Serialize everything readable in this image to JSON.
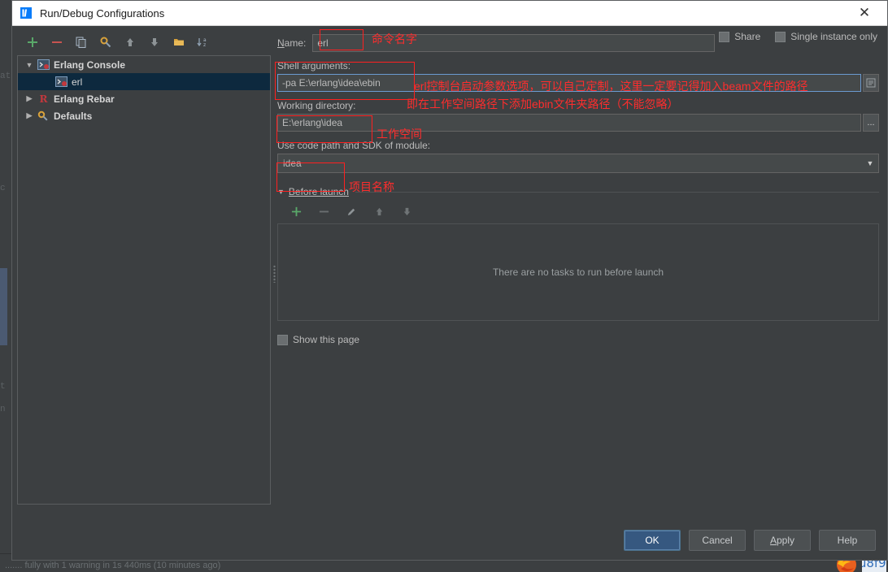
{
  "window": {
    "title": "Run/Debug Configurations",
    "app_icon": "intellij-idea-icon",
    "close_icon": "close-icon"
  },
  "left_pane": {
    "toolbar": [
      {
        "name": "add-button",
        "icon": "plus-icon",
        "glyph": "+"
      },
      {
        "name": "remove-button",
        "icon": "minus-icon",
        "glyph": "−"
      },
      {
        "name": "copy-button",
        "icon": "copy-icon",
        "glyph": "❐"
      },
      {
        "name": "edit-templates-button",
        "icon": "wrench-gear-icon",
        "glyph": "⚙"
      },
      {
        "name": "move-up-button",
        "icon": "arrow-up-icon",
        "glyph": "↑"
      },
      {
        "name": "move-down-button",
        "icon": "arrow-down-icon",
        "glyph": "↓"
      },
      {
        "name": "move-into-folder-button",
        "icon": "folder-icon",
        "glyph": "▬"
      },
      {
        "name": "sort-button",
        "icon": "sort-alphabetical-icon",
        "glyph": "↓az"
      }
    ],
    "tree": [
      {
        "label": "Erlang Console",
        "level": 0,
        "expanded": true,
        "twisty": "▼",
        "icon": "erlang-console-icon",
        "selected": false,
        "bold": true
      },
      {
        "label": "erl",
        "level": 1,
        "expanded": null,
        "twisty": "",
        "icon": "erlang-console-icon",
        "selected": true,
        "bold": false
      },
      {
        "label": "Erlang Rebar",
        "level": 0,
        "expanded": false,
        "twisty": "▶",
        "icon": "erlang-rebar-icon",
        "selected": false,
        "bold": true
      },
      {
        "label": "Defaults",
        "level": 0,
        "expanded": false,
        "twisty": "▶",
        "icon": "defaults-gear-icon",
        "selected": false,
        "bold": true
      }
    ]
  },
  "form": {
    "name_label": "Name:",
    "name_value": "erl",
    "share_label": "Share",
    "share_checked": false,
    "single_instance_label": "Single instance only",
    "single_instance_checked": false,
    "shell_arguments_label": "Shell arguments:",
    "shell_arguments_value": "-pa E:\\erlang\\idea\\ebin",
    "shell_arguments_expand_icon": "expand-editor-icon",
    "working_directory_label": "Working directory:",
    "working_directory_value": "E:\\erlang\\idea",
    "working_directory_browse_label": "...",
    "module_label": "Use code path and SDK of module:",
    "module_value": "idea",
    "module_dropdown_icon": "chevron-down-icon",
    "before_launch_label": "Before launch",
    "before_launch_toolbar": [
      {
        "name": "before-launch-add-button",
        "icon": "plus-icon",
        "glyph": "+"
      },
      {
        "name": "before-launch-remove-button",
        "icon": "minus-icon",
        "glyph": "−"
      },
      {
        "name": "before-launch-edit-button",
        "icon": "pencil-icon",
        "glyph": "✎"
      },
      {
        "name": "before-launch-move-up-button",
        "icon": "arrow-up-icon",
        "glyph": "↑"
      },
      {
        "name": "before-launch-move-down-button",
        "icon": "arrow-down-icon",
        "glyph": "↓"
      }
    ],
    "no_tasks_text": "There are no tasks to run before launch",
    "show_this_page_label": "Show this page",
    "show_this_page_checked": false
  },
  "footer": {
    "ok_label": "OK",
    "cancel_label": "Cancel",
    "apply_label": "Apply",
    "help_label": "Help"
  },
  "annotations": {
    "name_note": "命令名字",
    "shell_note_line1": "erl控制台启动参数选项，可以自己定制，这里一定要记得加入beam文件的路径",
    "shell_note_line2": "即在工作空间路径下添加ebin文件夹路径（不能忽略）",
    "workdir_note": "工作空间",
    "module_note": "项目名称"
  },
  "background": {
    "status_text": "....... fully with 1 warning in 1s 440ms (10 minutes ago)",
    "accent_blue": "#365880",
    "annotation_red": "#ff2d2d",
    "panel_bg": "#3c3f41",
    "editor_bg": "#2b2b2b",
    "selection_bg": "#0d293e"
  }
}
